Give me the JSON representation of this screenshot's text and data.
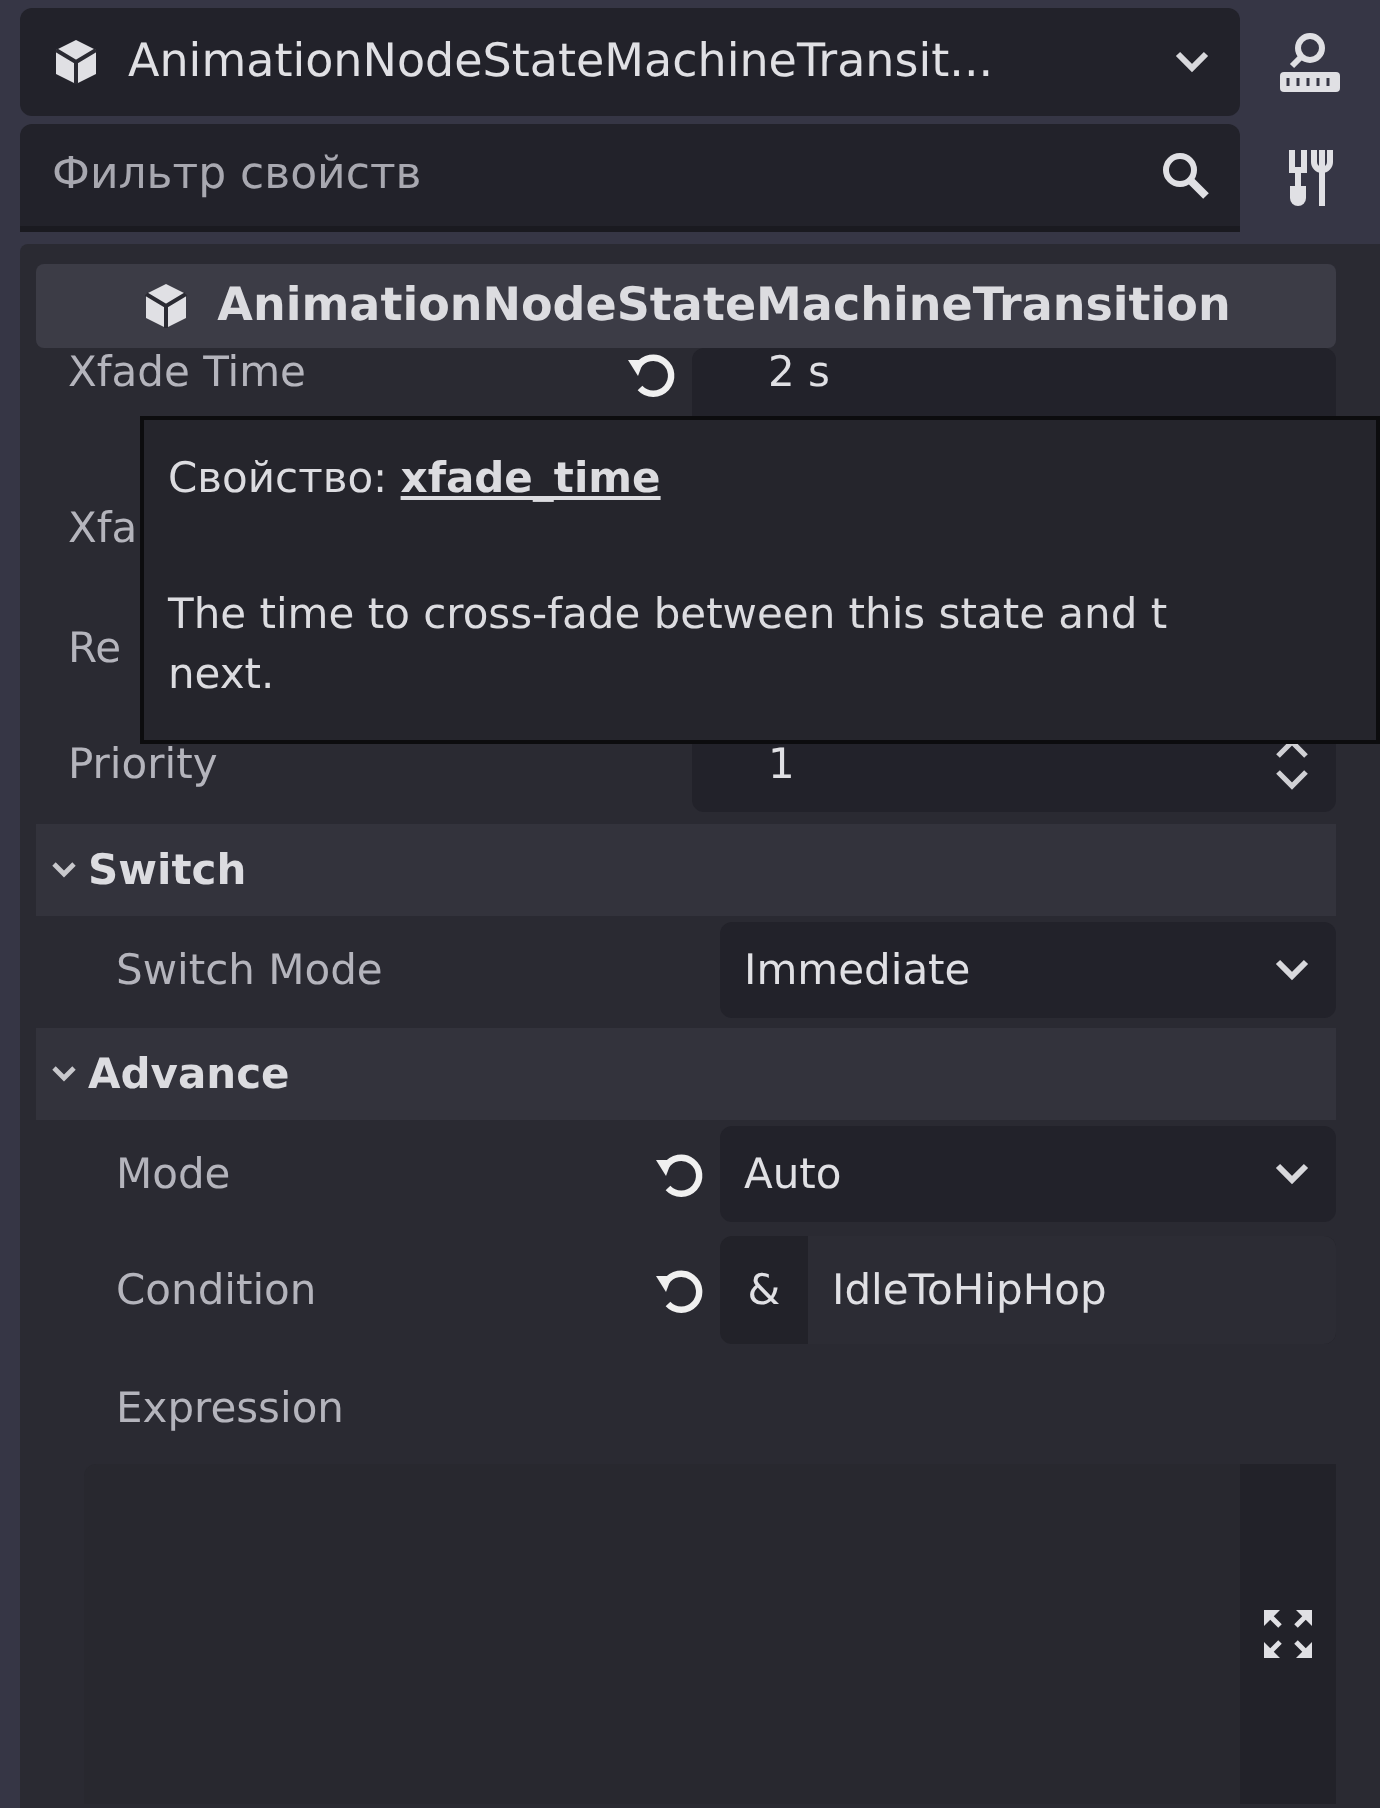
{
  "object_selector": {
    "value": "AnimationNodeStateMachineTransit..."
  },
  "filter": {
    "placeholder": "Фильтр свойств"
  },
  "class_header": {
    "title": "AnimationNodeStateMachineTransition"
  },
  "properties": [
    {
      "kind": "number",
      "label": "Xfade Time",
      "value": "2 s",
      "revertable": true
    },
    {
      "kind": "covered",
      "label": "Xfa"
    },
    {
      "kind": "covered",
      "label": "Re"
    },
    {
      "kind": "spin",
      "label": "Priority",
      "value": "1"
    }
  ],
  "sections": [
    {
      "title": "Switch",
      "expanded": true,
      "properties": [
        {
          "kind": "dropdown",
          "label": "Switch Mode",
          "value": "Immediate"
        }
      ]
    },
    {
      "title": "Advance",
      "expanded": true,
      "properties": [
        {
          "kind": "dropdown",
          "label": "Mode",
          "value": "Auto",
          "revertable": true
        },
        {
          "kind": "condition",
          "label": "Condition",
          "prefix": "&",
          "value": "IdleToHipHop",
          "revertable": true
        },
        {
          "kind": "expression",
          "label": "Expression"
        }
      ]
    }
  ],
  "tooltip": {
    "title": "Свойство: **xfade_time**",
    "lines": [
      "The time to cross-fade between this state and t",
      "next."
    ]
  }
}
